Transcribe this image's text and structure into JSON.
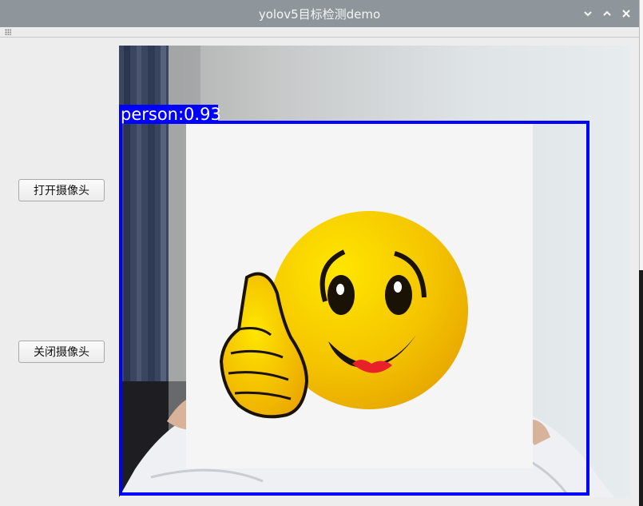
{
  "window": {
    "title": "yolov5目标检测demo",
    "controls": [
      "chevron-down-icon",
      "chevron-up-icon",
      "close-icon"
    ]
  },
  "buttons": {
    "open_camera": "打开摄像头",
    "close_camera": "关闭摄像头"
  },
  "detection": {
    "label": "person:0.93",
    "box_color": "#0000ff"
  },
  "colors": {
    "titlebar": "#8e969b",
    "window_bg": "#ededed",
    "emoji_yellow": "#f2c800"
  }
}
